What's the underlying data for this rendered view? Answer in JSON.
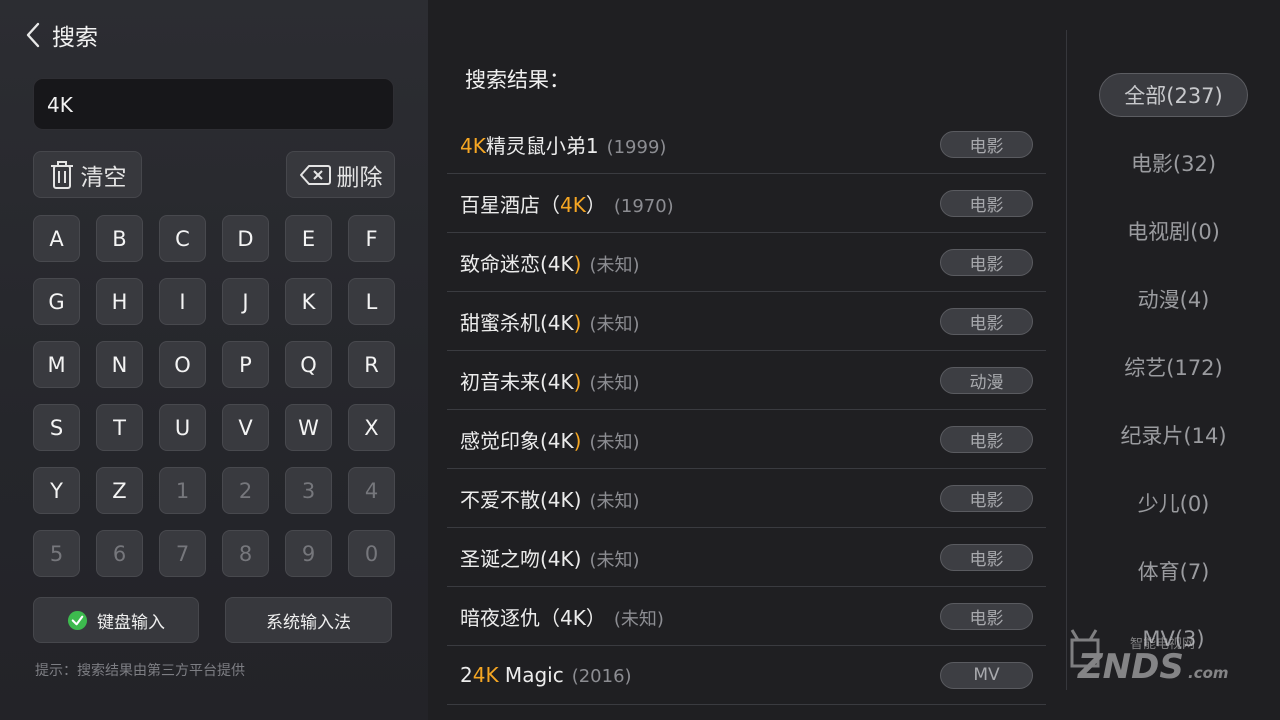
{
  "header": {
    "title": "搜索"
  },
  "search": {
    "value": "4K"
  },
  "actions": {
    "clear_label": "清空",
    "delete_label": "删除"
  },
  "keys": [
    "A",
    "B",
    "C",
    "D",
    "E",
    "F",
    "G",
    "H",
    "I",
    "J",
    "K",
    "L",
    "M",
    "N",
    "O",
    "P",
    "Q",
    "R",
    "S",
    "T",
    "U",
    "V",
    "W",
    "X",
    "Y",
    "Z",
    "1",
    "2",
    "3",
    "4",
    "5",
    "6",
    "7",
    "8",
    "9",
    "0"
  ],
  "input_modes": {
    "keyboard_label": "键盘输入",
    "system_label": "系统输入法"
  },
  "hint": "提示：搜索结果由第三方平台提供",
  "results_title": "搜索结果：",
  "results": [
    {
      "pre": "",
      "hl": "4K",
      "post": "精灵鼠小弟1",
      "year": "(1999)",
      "tag": "电影"
    },
    {
      "pre": "百星酒店（",
      "hl": "4K",
      "post": "）",
      "year": "(1970)",
      "tag": "电影"
    },
    {
      "pre": "致命迷恋(4K",
      "hl": ")",
      "post": "",
      "year": "(未知)",
      "tag": "电影"
    },
    {
      "pre": "甜蜜杀机(4K",
      "hl": ")",
      "post": "",
      "year": "(未知)",
      "tag": "电影"
    },
    {
      "pre": "初音未来(4K",
      "hl": ")",
      "post": "",
      "year": "(未知)",
      "tag": "动漫"
    },
    {
      "pre": "感觉印象(4K",
      "hl": ")",
      "post": "",
      "year": "(未知)",
      "tag": "电影"
    },
    {
      "pre": "不爱不散(4K)",
      "hl": "",
      "post": "",
      "year": "(未知)",
      "tag": "电影"
    },
    {
      "pre": "圣诞之吻(4K)",
      "hl": "",
      "post": "",
      "year": "(未知)",
      "tag": "电影"
    },
    {
      "pre": "暗夜逐仇（4K）",
      "hl": "",
      "post": "",
      "year": "(未知)",
      "tag": "电影"
    },
    {
      "pre": "2",
      "hl": "4K",
      "post": " Magic",
      "year": "(2016)",
      "tag": "MV"
    }
  ],
  "categories": [
    {
      "label": "全部(237)",
      "active": true
    },
    {
      "label": "电影(32)",
      "active": false
    },
    {
      "label": "电视剧(0)",
      "active": false
    },
    {
      "label": "动漫(4)",
      "active": false
    },
    {
      "label": "综艺(172)",
      "active": false
    },
    {
      "label": "纪录片(14)",
      "active": false
    },
    {
      "label": "少儿(0)",
      "active": false
    },
    {
      "label": "体育(7)",
      "active": false
    },
    {
      "label": "MV(3)",
      "active": false
    }
  ],
  "watermark": {
    "top": "智能电视网",
    "main": "ZNDS",
    "suffix": ".com"
  },
  "colors": {
    "highlight": "#f5a623",
    "check_green": "#3dba4e"
  }
}
